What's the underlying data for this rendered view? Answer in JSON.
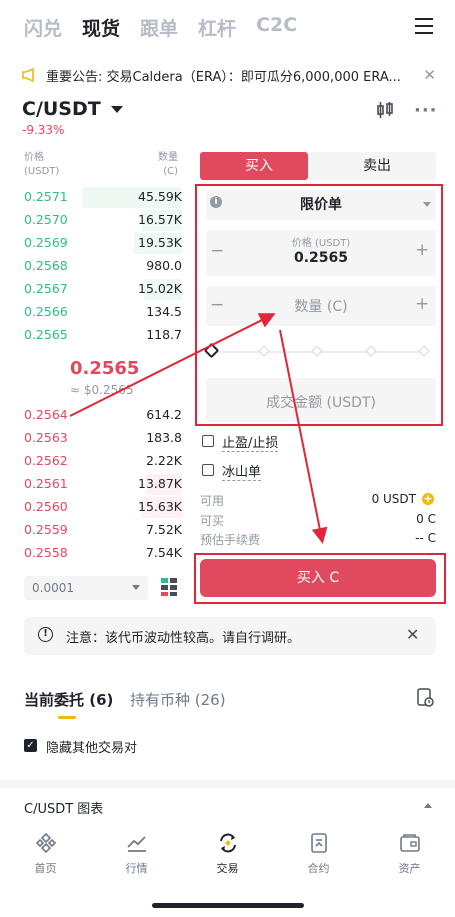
{
  "top_tabs": [
    "闪兑",
    "现货",
    "跟单",
    "杠杆",
    "C2C"
  ],
  "announcement": "重要公告: 交易Caldera（ERA）：即可瓜分6,000,000 ERA...",
  "pair": {
    "name": "C/USDT",
    "change": "-9.33%"
  },
  "orderbook": {
    "price_header": "价格",
    "price_unit": "(USDT)",
    "qty_header": "数量",
    "qty_unit": "(C)",
    "asks": [
      {
        "price": "0.2571",
        "qty": "45.59K"
      },
      {
        "price": "0.2570",
        "qty": "16.57K"
      },
      {
        "price": "0.2569",
        "qty": "19.53K"
      },
      {
        "price": "0.2568",
        "qty": "980.0"
      },
      {
        "price": "0.2567",
        "qty": "15.02K"
      },
      {
        "price": "0.2566",
        "qty": "134.5"
      },
      {
        "price": "0.2565",
        "qty": "118.7"
      }
    ],
    "mid_price": "0.2565",
    "mid_usd": "≈ $0.2565",
    "bids": [
      {
        "price": "0.2564",
        "qty": "614.2"
      },
      {
        "price": "0.2563",
        "qty": "183.8"
      },
      {
        "price": "0.2562",
        "qty": "2.22K"
      },
      {
        "price": "0.2561",
        "qty": "13.87K"
      },
      {
        "price": "0.2560",
        "qty": "15.63K"
      },
      {
        "price": "0.2559",
        "qty": "7.52K"
      },
      {
        "price": "0.2558",
        "qty": "7.54K"
      }
    ],
    "precision": "0.0001"
  },
  "trade": {
    "buy_tab": "买入",
    "sell_tab": "卖出",
    "order_type": "限价单",
    "price_label": "价格 (USDT)",
    "price_value": "0.2565",
    "qty_placeholder": "数量 (C)",
    "total_placeholder": "成交金额 (USDT)",
    "tpsl_label": "止盈/止损",
    "iceberg_label": "冰山单",
    "available_label": "可用",
    "available_value": "0 USDT",
    "can_buy_label": "可买",
    "can_buy_value": "0 C",
    "fee_label": "预估手续费",
    "fee_value": "-- C",
    "buy_button": "买入 C"
  },
  "notice": "注意：该代币波动性较高。请自行调研。",
  "orders_tabs": {
    "open": "当前委托 (6)",
    "holdings": "持有币种 (26)"
  },
  "hide_other_pairs": "隐藏其他交易对",
  "chart_label": "C/USDT 图表",
  "nav": [
    "首页",
    "行情",
    "交易",
    "合约",
    "资产"
  ],
  "colors": {
    "buy": "#e0495e",
    "ask": "#2ebd85",
    "accent": "#f0b90b",
    "annotation": "#e0273a"
  }
}
